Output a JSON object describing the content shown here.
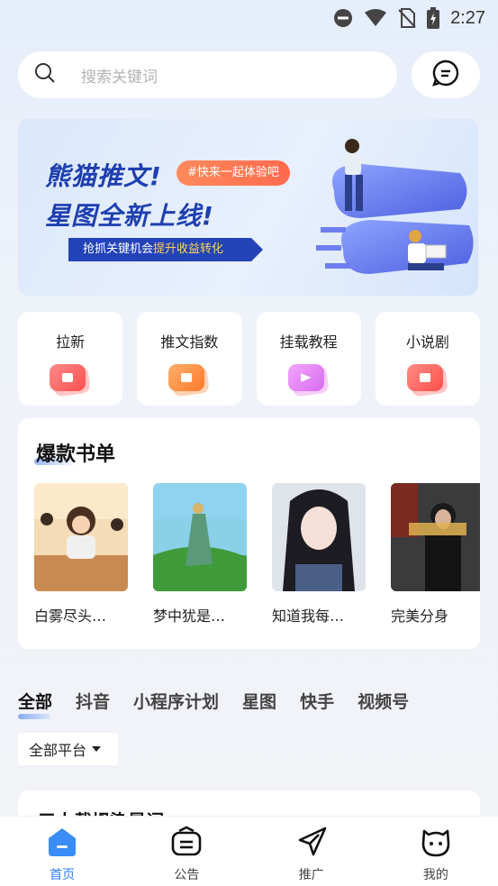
{
  "status_bar": {
    "time": "2:27"
  },
  "search": {
    "placeholder": "搜索关键词"
  },
  "banner": {
    "line1": "熊猫推文!",
    "line2": "星图全新上线!",
    "tag": "#快来一起体验吧",
    "sub_prefix": "抢抓关键机会",
    "sub_highlight": "提升收益转化"
  },
  "quick_entries": [
    {
      "label": "拉新",
      "color": "#ff5a5a"
    },
    {
      "label": "推文指数",
      "color": "#ff7a2a"
    },
    {
      "label": "挂载教程",
      "color": "#e16cf0"
    },
    {
      "label": "小说剧",
      "color": "#ff5550"
    }
  ],
  "hot_books": {
    "title": "爆款书单",
    "items": [
      {
        "name": "白雾尽头…"
      },
      {
        "name": "梦中犹是…"
      },
      {
        "name": "知道我每…"
      },
      {
        "name": "完美分身"
      }
    ]
  },
  "tabs": [
    "全部",
    "抖音",
    "小程序计划",
    "星图",
    "快手",
    "视频号"
  ],
  "platform_filter": "全部平台",
  "list": {
    "first_title": "三人载坍染是词"
  },
  "bottom_nav": [
    {
      "label": "首页",
      "icon": "home-icon",
      "active": true
    },
    {
      "label": "公告",
      "icon": "announcement-icon",
      "active": false
    },
    {
      "label": "推广",
      "icon": "paper-plane-icon",
      "active": false
    },
    {
      "label": "我的",
      "icon": "profile-face-icon",
      "active": false
    }
  ],
  "colors": {
    "accent": "#2f7ef5",
    "brand_blue": "#1e3fb0"
  }
}
